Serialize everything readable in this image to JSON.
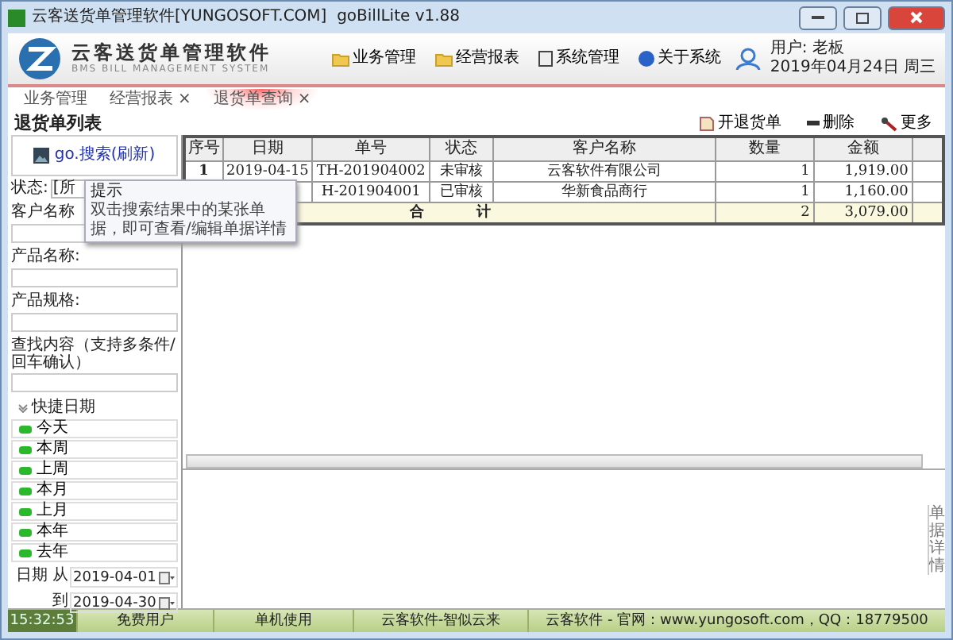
{
  "window": {
    "title": "云客送货单管理软件[YUNGOSOFT.COM]  goBillLite v1.88"
  },
  "header": {
    "logo_title": "云客送货单管理软件",
    "logo_subtitle": "BMS BILL MANAGEMENT SYSTEM",
    "menu": [
      "业务管理",
      "经营报表",
      "系统管理",
      "关于系统"
    ],
    "user": "用户: 老板",
    "date": "2019年04月24日 周三"
  },
  "tabs": [
    {
      "label": "业务管理",
      "selected": false
    },
    {
      "label": "经营报表",
      "close": "×",
      "selected": false
    },
    {
      "label": "退货单查询",
      "close": "×",
      "selected": true
    }
  ],
  "page_title": "退货单列表",
  "toolbar": [
    "开退货单",
    "删除",
    "更多"
  ],
  "sidebar": {
    "search_button": "go.搜索(刷新)",
    "status_label": "状态:",
    "status_value": "[所",
    "fields": [
      {
        "label": "客户名称"
      },
      {
        "label": "产品名称:"
      },
      {
        "label": "产品规格:"
      },
      {
        "label": "查找内容（支持多条件/回车确认）"
      }
    ],
    "quick_dates": {
      "title": "快捷日期",
      "expanded": true,
      "items": [
        "今天",
        "本周",
        "上周",
        "本月",
        "上月",
        "本年",
        "去年"
      ]
    },
    "date_from_label": "日期 从",
    "date_from": "2019-04-01",
    "date_to_label": "到",
    "date_to": "2019-04-30"
  },
  "tooltip": {
    "title": "提示",
    "text": "双击搜索结果中的某张单据，即可查看/编辑单据详情"
  },
  "table": {
    "columns": [
      "序号",
      "日期",
      "单号",
      "状态",
      "客户名称",
      "数量",
      "金额"
    ],
    "rows": [
      {
        "seq": "1",
        "date": "2019-04-15",
        "number": "TH-201904002",
        "status": "未审核",
        "customer": "云客软件有限公司",
        "quantity": "1",
        "amount": "1,919.00"
      },
      {
        "number": "H-201904001",
        "status": "已审核",
        "customer": "华新食品商行",
        "quantity": "1",
        "amount": "1,160.00"
      }
    ],
    "total": {
      "label": "合 计",
      "quantity": "2",
      "amount": "3,079.00"
    }
  },
  "detail_tab": "单据详情",
  "status_bar": [
    "15:32:53",
    "免费用户",
    "单机使用",
    "云客软件-智似云来",
    "云客软件 - 官网：www.yungosoft.com，QQ：18779500"
  ]
}
